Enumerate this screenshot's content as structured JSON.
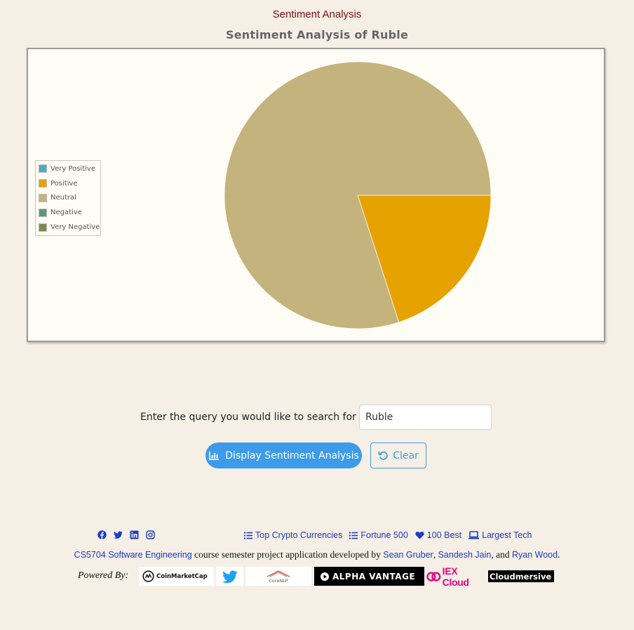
{
  "header": {
    "title": "Sentiment Analysis"
  },
  "chart_data": {
    "type": "pie",
    "title": "Sentiment Analysis of Ruble",
    "categories": [
      "Very Positive",
      "Positive",
      "Neutral",
      "Negative",
      "Very Negative"
    ],
    "values": [
      0,
      20,
      80,
      0,
      0
    ],
    "colors": [
      "#4bacc6",
      "#e6a200",
      "#c4b37c",
      "#5a9a7a",
      "#7b8a4f"
    ],
    "legend_position": "left",
    "grid": false
  },
  "search": {
    "label": "Enter the query you would like to search for",
    "required_marker": "*",
    "value": "Ruble"
  },
  "buttons": {
    "display_label": "Display Sentiment Analysis",
    "clear_label": "Clear"
  },
  "footer": {
    "social_icons": [
      "facebook-icon",
      "twitter-icon",
      "linkedin-icon",
      "instagram-icon"
    ],
    "nav": [
      {
        "label": "Top Crypto Currencies",
        "icon": "list-icon"
      },
      {
        "label": "Fortune 500",
        "icon": "list-icon"
      },
      {
        "label": "100 Best",
        "icon": "heart-icon"
      },
      {
        "label": "Largest Tech",
        "icon": "laptop-icon"
      }
    ],
    "credit": {
      "course": "CS5704 Software Engineering",
      "middle": " course semester project application developed by ",
      "author1": "Sean Gruber",
      "sep1": ", ",
      "author2": "Sandesh Jain",
      "sep2": ", and ",
      "author3": "Ryan Wood",
      "end": "."
    },
    "powered_by": "Powered By:",
    "logos": {
      "coinmarketcap": "CoinMarketCap",
      "corenlp": "CoreNLP",
      "alphavantage": "ALPHA VANTAGE",
      "iexcloud": "IEX Cloud",
      "cloudmersive": "Cloudmersive"
    }
  }
}
